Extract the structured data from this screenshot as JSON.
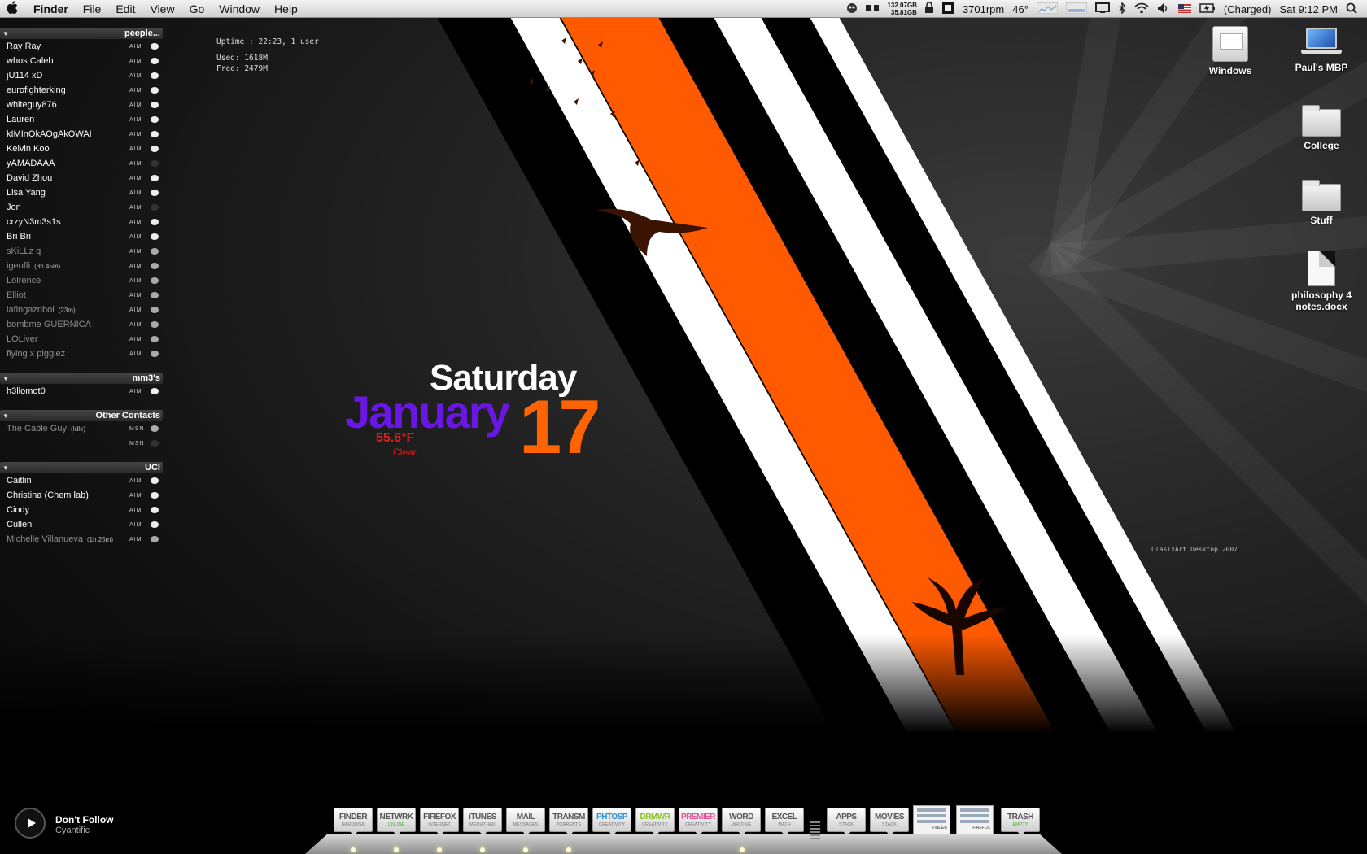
{
  "menubar": {
    "app_name": "Finder",
    "menus": [
      "File",
      "Edit",
      "View",
      "Go",
      "Window",
      "Help"
    ],
    "disk_free": "132.07GB",
    "disk_used": "35.81GB",
    "fan_speed": "3701rpm",
    "temperature": "46°",
    "battery": "(Charged)",
    "clock": "Sat 9:12 PM"
  },
  "buddy_list": {
    "groups": [
      {
        "name": "peeple...",
        "buddies": [
          {
            "name": "Ray Ray",
            "service": "AIM",
            "idle_time": ""
          },
          {
            "name": "whos Caleb",
            "service": "AIM",
            "idle_time": ""
          },
          {
            "name": "jU114 xD",
            "service": "AIM",
            "idle_time": ""
          },
          {
            "name": "eurofighterking",
            "service": "AIM",
            "idle_time": ""
          },
          {
            "name": "whiteguy876",
            "service": "AIM",
            "idle_time": ""
          },
          {
            "name": "Lauren",
            "service": "AIM",
            "idle_time": ""
          },
          {
            "name": "kIMInOkAOgAkOWAI",
            "service": "AIM",
            "idle_time": ""
          },
          {
            "name": "Kelvin Koo",
            "service": "AIM",
            "idle_time": ""
          },
          {
            "name": "yAMADAAA",
            "service": "AIM",
            "idle_time": ""
          },
          {
            "name": "David Zhou",
            "service": "AIM",
            "idle_time": ""
          },
          {
            "name": "Lisa Yang",
            "service": "AIM",
            "idle_time": ""
          },
          {
            "name": "Jon",
            "service": "AIM",
            "idle_time": ""
          },
          {
            "name": "crzyN3m3s1s",
            "service": "AIM",
            "idle_time": ""
          },
          {
            "name": "Bri Bri",
            "service": "AIM",
            "idle_time": ""
          },
          {
            "name": "sKiLLz q",
            "service": "AIM",
            "idle_time": ""
          },
          {
            "name": "igeoffi",
            "service": "AIM",
            "idle_time": "(3h 45m)"
          },
          {
            "name": "Lolrence",
            "service": "AIM",
            "idle_time": ""
          },
          {
            "name": "Elliot",
            "service": "AIM",
            "idle_time": ""
          },
          {
            "name": "lafingaznboi",
            "service": "AIM",
            "idle_time": "(23m)"
          },
          {
            "name": "bombme  GUERNICA",
            "service": "AIM",
            "idle_time": ""
          },
          {
            "name": "LOLiver",
            "service": "AIM",
            "idle_time": ""
          },
          {
            "name": "flying x piggiez",
            "service": "AIM",
            "idle_time": ""
          }
        ]
      },
      {
        "name": "mm3's",
        "buddies": [
          {
            "name": "h3llomot0",
            "service": "AIM",
            "idle_time": ""
          }
        ]
      },
      {
        "name": "Other Contacts",
        "buddies": [
          {
            "name": "The Cable Guy",
            "service": "MSN",
            "idle_time": "(Idle)"
          },
          {
            "name": "",
            "service": "MSN",
            "idle_time": ""
          }
        ]
      },
      {
        "name": "UCI",
        "buddies": [
          {
            "name": "Caitlin",
            "service": "AIM",
            "idle_time": ""
          },
          {
            "name": "Christina (Chem lab)",
            "service": "AIM",
            "idle_time": ""
          },
          {
            "name": "Cindy",
            "service": "AIM",
            "idle_time": ""
          },
          {
            "name": "Cullen",
            "service": "AIM",
            "idle_time": ""
          },
          {
            "name": "Michelle Villanueva",
            "service": "AIM",
            "idle_time": "(1h 25m)"
          }
        ]
      }
    ]
  },
  "stats": {
    "uptime": "Uptime : 22:23, 1 user",
    "used": "Used: 1618M",
    "free": "Free: 2479M"
  },
  "date_widget": {
    "day_name": "Saturday",
    "month": "January",
    "day": "17",
    "temperature": "55.6°F",
    "condition": "Clear"
  },
  "wallpaper_credit": "ClasixArt Desktop 2007",
  "desktop_icons": [
    {
      "label": "Windows",
      "icon": "hard-drive-icon"
    },
    {
      "label": "Paul's MBP",
      "icon": "laptop-icon"
    },
    {
      "label": "College",
      "icon": "folder-icon"
    },
    {
      "label": "Stuff",
      "icon": "folder-icon"
    },
    {
      "label": "philosophy 4 notes.docx",
      "icon": "document-icon"
    }
  ],
  "now_playing": {
    "title": "Don't Follow",
    "artist": "Cyantific"
  },
  "dock": {
    "items": [
      {
        "label": "FINDER",
        "sub": "HARDDISK",
        "color": "#555555"
      },
      {
        "label": "NETWRK",
        "sub": "ONLINE",
        "color": "#555555",
        "sub_color": "#3fae2a"
      },
      {
        "label": "FIREFOX",
        "sub": "INTERNET",
        "color": "#555555"
      },
      {
        "label": "iTUNES",
        "sub": "MEDIATHEK",
        "color": "#555555"
      },
      {
        "label": "MAIL",
        "sub": "MESSAGES",
        "color": "#555555"
      },
      {
        "label": "TRANSM",
        "sub": "TORRENTS",
        "color": "#555555"
      },
      {
        "label": "PHTOSP",
        "sub": "CREATIVITY",
        "color": "#2b8fd6"
      },
      {
        "label": "DRMWR",
        "sub": "CREATIVITY",
        "color": "#8bc22a"
      },
      {
        "label": "PREMIER",
        "sub": "CREATIVITY",
        "color": "#e0559b"
      },
      {
        "label": "WORD",
        "sub": "WRITING",
        "color": "#555555"
      },
      {
        "label": "EXCEL",
        "sub": "MATH",
        "color": "#555555"
      },
      {
        "label": "APPS",
        "sub": "STACK",
        "color": "#555555"
      },
      {
        "label": "MOVIES",
        "sub": "STACK",
        "color": "#555555"
      },
      {
        "label": "TRASH",
        "sub": "EMPTY",
        "color": "#555555",
        "sub_color": "#3fae2a"
      }
    ],
    "thumbnails": [
      {
        "label": "FINDER"
      },
      {
        "label": "FIREFOX"
      }
    ]
  },
  "colors": {
    "orange": "#ff6400",
    "purple": "#6a17e6",
    "red": "#e01b1b"
  }
}
